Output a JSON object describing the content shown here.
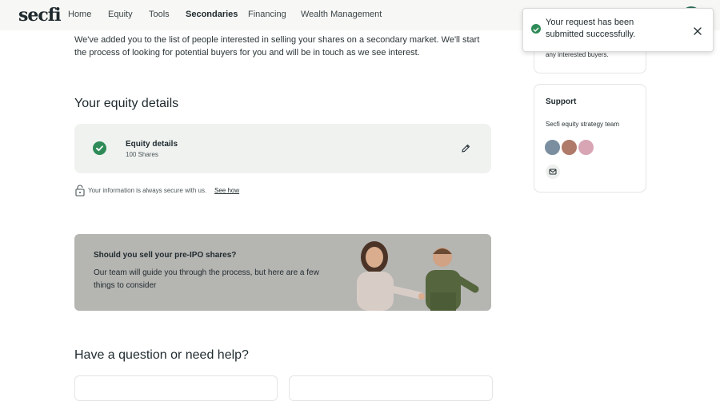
{
  "nav": {
    "logo": "secfi",
    "items": [
      "Home",
      "Equity",
      "Tools",
      "Secondaries",
      "Financing",
      "Wealth Management"
    ],
    "active": "Secondaries"
  },
  "intro": {
    "text": "We've added you to the list of people interested in selling your shares on a secondary market. We'll start the process of looking for potential buyers for you and will be in touch as we see interest."
  },
  "equity_section": {
    "title": "Your equity details",
    "card_title": "Equity details",
    "card_sub": "100 Shares",
    "secure_text": "Your information is always secure with us.",
    "see_how": "See how"
  },
  "promo": {
    "title": "Should you sell your pre-IPO shares?",
    "body": "Our team will guide you through the process, but here are a few things to consider"
  },
  "help": {
    "title": "Have a question or need help?"
  },
  "right_card": {
    "text": "any interested buyers."
  },
  "support": {
    "title": "Support",
    "team": "Secfi equity strategy team",
    "colors": [
      "#7a8ea0",
      "#b07a6a",
      "#d8a5b5"
    ]
  },
  "toast": {
    "message": "Your request has been submitted successfully."
  },
  "colors": {
    "accent_green": "#2e8b57",
    "promo_bg": "#b5b5b2",
    "card_bg": "#f0f2f0"
  }
}
